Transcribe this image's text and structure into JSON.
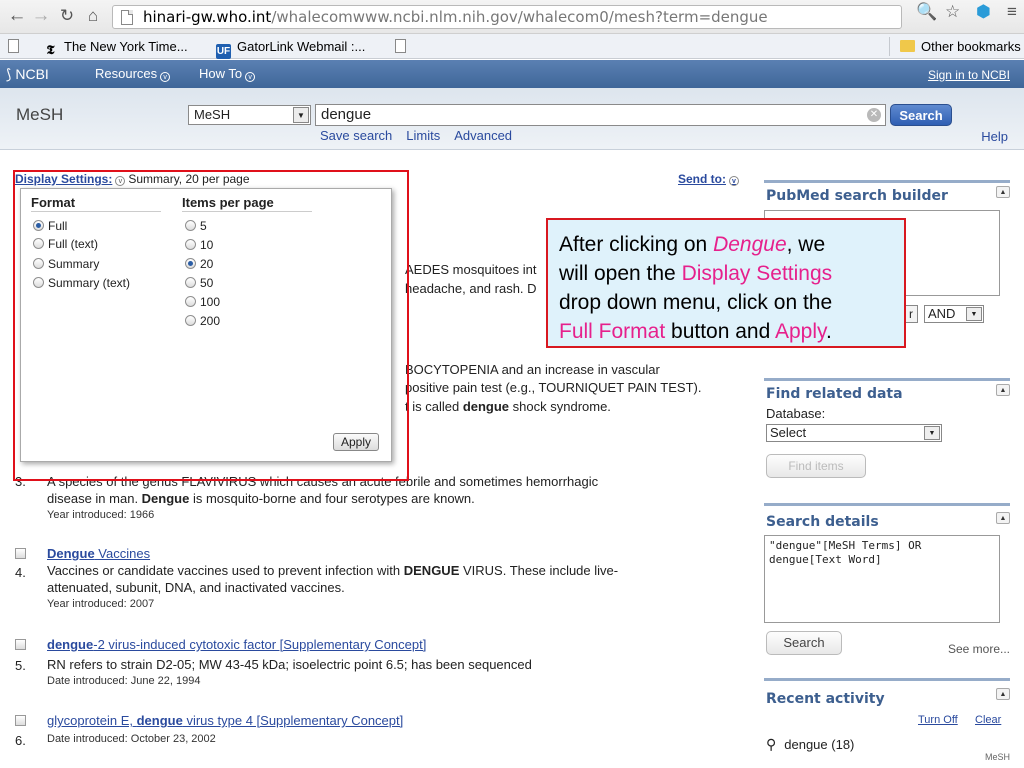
{
  "browser": {
    "url_scheme_host": "hinari-gw.who.int",
    "url_path": "/whalecomwww.ncbi.nlm.nih.gov/whalecom0/mesh?term=dengue",
    "bookmarks": [
      {
        "label": "The New York Time..."
      },
      {
        "label": "GatorLink Webmail :..."
      },
      {
        "label": ""
      }
    ],
    "other_bookmarks": "Other bookmarks"
  },
  "ncbi_bar": {
    "logo": "NCBI",
    "resources": "Resources",
    "howto": "How To",
    "signin": "Sign in to NCBI"
  },
  "search": {
    "db_title": "MeSH",
    "db_select": "MeSH",
    "term": "dengue",
    "search_button": "Search",
    "links": [
      "Save search",
      "Limits",
      "Advanced"
    ],
    "help": "Help"
  },
  "display_settings": {
    "label": "Display Settings:",
    "current": "Summary, 20 per page",
    "send_to": "Send to:",
    "format_heading": "Format",
    "formats": [
      "Full",
      "Full (text)",
      "Summary",
      "Summary (text)"
    ],
    "selected_format": "Full",
    "items_heading": "Items per page",
    "items": [
      "5",
      "10",
      "20",
      "50",
      "100",
      "200"
    ],
    "selected_items": "20",
    "apply": "Apply"
  },
  "partial_text": {
    "line1": "AEDES mosquitoes int",
    "line2": "headache, and rash. D",
    "line3": "BOCYTOPENIA and an increase in vascular",
    "line4a": "positive pain test (e.g., TOURNIQUET PAIN TEST).",
    "line5a": "t is called ",
    "line5b": "dengue",
    "line5c": " shock syndrome."
  },
  "results": [
    {
      "num": "3.",
      "desc_a": "A species of the genus FLAVIVIRUS which causes an acute febrile and sometimes hemorrhagic",
      "desc_b_pre": "disease in man. ",
      "desc_b_bold": "Dengue",
      "desc_b_post": " is mosquito-borne and four serotypes are known.",
      "year": "Year introduced: 1966"
    },
    {
      "num": "4.",
      "title_bold": "Dengue",
      "title_rest": " Vaccines",
      "desc_a_pre": "Vaccines or candidate vaccines used to prevent infection with ",
      "desc_a_bold": "DENGUE",
      "desc_a_post": " VIRUS. These include live-",
      "desc_b": "attenuated, subunit, DNA, and inactivated vaccines.",
      "year": "Year introduced: 2007"
    },
    {
      "num": "5.",
      "title_bold": "dengue",
      "title_rest": "-2 virus-induced cytotoxic factor [Supplementary Concept]",
      "desc_a": "RN refers to strain D2-05; MW 43-45 kDa; isoelectric point 6.5; has been sequenced",
      "year": "Date introduced: June 22, 1994"
    },
    {
      "num": "6.",
      "title_pre": "glycoprotein E, ",
      "title_bold": "dengue",
      "title_rest": " virus type 4 [Supplementary Concept]",
      "year": "Date introduced: October 23, 2002"
    }
  ],
  "callout": {
    "t1": "After clicking on ",
    "t2": "Dengue",
    "t3": ", we",
    "t4": "will open the ",
    "t5": "Display Settings",
    "t6": "drop down menu, click on the",
    "t7": "Full Format",
    "t8": " button and ",
    "t9": "Apply",
    "t10": "."
  },
  "sidebar": {
    "builder_title": "PubMed search builder",
    "builder_op_partial": "r",
    "builder_op": "AND",
    "related_title": "Find related data",
    "database_label": "Database:",
    "database_select": "Select",
    "find_items": "Find items",
    "details_title": "Search details",
    "details_text": "\"dengue\"[MeSH Terms] OR dengue[Text Word]",
    "details_search": "Search",
    "see_more": "See more...",
    "recent_title": "Recent activity",
    "turn_off": "Turn Off",
    "clear": "Clear",
    "recent_item": "dengue (18)",
    "recent_db": "MeSH"
  },
  "colors": {
    "ncbi_blue": "#4a71a6",
    "link": "#2a4a9e",
    "highlight": "#e6208c",
    "callout_bg": "#dff2fb",
    "annotation_red": "#e0101a"
  }
}
